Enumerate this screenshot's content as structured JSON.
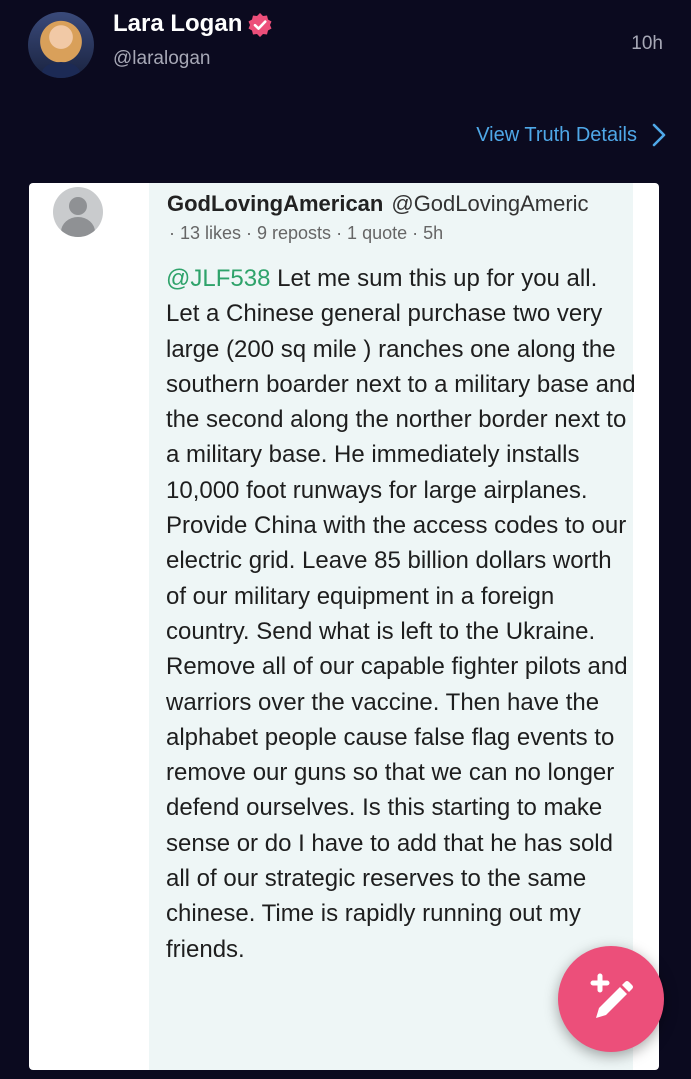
{
  "post": {
    "display_name": "Lara Logan",
    "handle": "@laralogan",
    "time": "10h",
    "verified_icon": "verified-badge-icon",
    "accent_color": "#ec4f7a"
  },
  "details_link": {
    "label": "View Truth Details",
    "icon": "chevron-right-icon",
    "color": "#4fa8e8"
  },
  "embedded_post": {
    "name": "GodLovingAmerican",
    "handle": "@GodLovingAmeric",
    "meta": "· 13 likes · 9 reposts · 1 quote · 5h",
    "mention": "@JLF538",
    "mention_color": "#2fa36b",
    "body": "Let me sum this up for you all. Let a Chinese general purchase two very large (200 sq mile ) ranches one along the southern boarder next to a military base and the second along the norther border next to a military base. He immediately installs 10,000 foot runways for large airplanes. Provide China with the access codes to our electric grid. Leave 85 billion dollars worth of our military equipment in a foreign country. Send what is left to the Ukraine. Remove all of our capable fighter pilots and warriors over the vaccine. Then have the alphabet people cause false flag events to remove our guns so that we can no longer defend ourselves. Is this starting to make sense or do I have to add that he has sold all of our strategic reserves to the same chinese. Time is rapidly running out my friends."
  },
  "compose_button": {
    "icon": "compose-pencil-icon",
    "color": "#ec4f7a"
  }
}
